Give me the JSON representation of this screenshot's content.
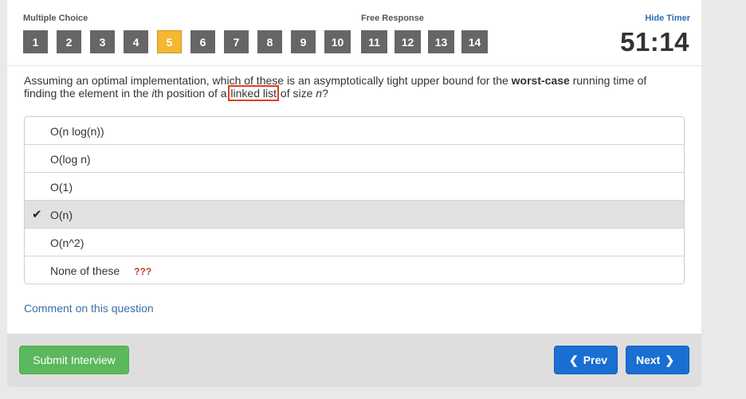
{
  "header": {
    "multiple_choice_label": "Multiple Choice",
    "free_response_label": "Free Response",
    "hide_timer_label": "Hide Timer",
    "timer": "51:14",
    "question_numbers": [
      "1",
      "2",
      "3",
      "4",
      "5",
      "6",
      "7",
      "8",
      "9",
      "10",
      "11",
      "12",
      "13",
      "14"
    ],
    "active_question": "5"
  },
  "question": {
    "part1": "Assuming an optimal implementation, which of these is an asymptotically tight upper bound for the ",
    "bold": "worst-case",
    "part2": " running time of finding the element in the ",
    "italic_i": "i",
    "part3": "th position of a",
    "highlight": "linked list",
    "part4": "of size ",
    "italic_n": "n",
    "part5": "?"
  },
  "answers": [
    {
      "label": "O(n log(n))"
    },
    {
      "label": "O(log n)"
    },
    {
      "label": "O(1)"
    },
    {
      "label": "O(n)",
      "selected": true
    },
    {
      "label": "O(n^2)"
    },
    {
      "label": "None of these",
      "annotation": "???"
    }
  ],
  "comment_link": "Comment on this question",
  "footer": {
    "submit_label": "Submit Interview",
    "prev_label": "Prev",
    "next_label": "Next"
  },
  "colors": {
    "active_question": "#f5b731",
    "question_button": "#666666",
    "submit": "#5cb85c",
    "nav": "#1a6fd4",
    "highlight_border": "#e04020"
  }
}
